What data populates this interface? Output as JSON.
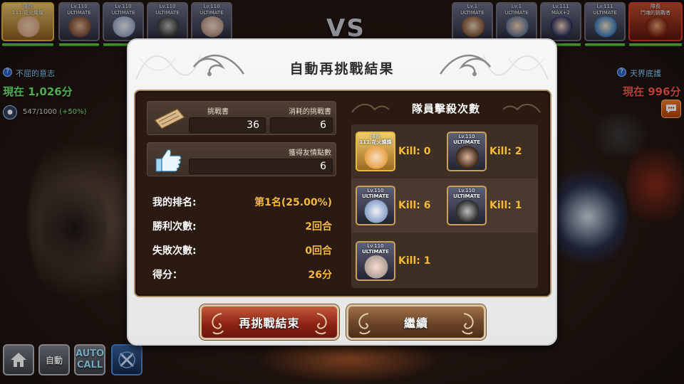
{
  "colors": {
    "gold_text": "#f5b93a",
    "player_score": "#6ff06a",
    "enemy_score": "#ff5a4a",
    "info_blue": "#8fd0ff",
    "end_button": "#8e2414",
    "continue_button": "#6b4428"
  },
  "battle": {
    "vs": "VS",
    "player_team": [
      {
        "level": "隊長",
        "tier": "111.花火燦燦",
        "role": "leader",
        "hp": 1.0
      },
      {
        "level": "Lv.110",
        "tier": "ULTIMATE",
        "hp": 1.0
      },
      {
        "level": "Lv.110",
        "tier": "ULTIMATE",
        "hp": 1.0
      },
      {
        "level": "Lv.110",
        "tier": "ULTIMATE",
        "hp": 1.0
      },
      {
        "level": "Lv.110",
        "tier": "ULTIMATE",
        "hp": 1.0
      }
    ],
    "enemy_team": [
      {
        "level": "Lv.1",
        "tier": "ULTIMATE",
        "hp": 1.0
      },
      {
        "level": "Lv.1",
        "tier": "ULTIMATE",
        "hp": 1.0
      },
      {
        "level": "Lv.111",
        "tier": "MAX+2",
        "hp": 1.0
      },
      {
        "level": "Lv.111",
        "tier": "ULTIMATE",
        "hp": 1.0
      },
      {
        "level": "隊長",
        "tier": "鬥魂的挑戰者",
        "role": "enemy-leader",
        "hp": 1.0
      }
    ],
    "player_title": "不屈的意志",
    "player_score": "現在 1,026分",
    "player_energy": "547/1000",
    "player_energy_bonus": "(+50%)",
    "enemy_title": "天界底護",
    "enemy_score": "現在 996分"
  },
  "bottom_controls": {
    "home_icon": "home-icon",
    "auto_label": "自動",
    "auto_call_label": "AUTO\nCALL",
    "skill_icon": "crossed-swords-icon"
  },
  "modal": {
    "title": "自動再挑戰結果",
    "tickets_label": "挑戰書",
    "tickets_value": "36",
    "consumed_label": "消耗的挑戰書",
    "consumed_value": "6",
    "friendship_label": "獲得友情點數",
    "friendship_value": "6",
    "stats": [
      {
        "label": "我的排名:",
        "value": "第1名(25.00%)"
      },
      {
        "label": "勝利次數:",
        "value": "2回合"
      },
      {
        "label": "失敗次數:",
        "value": "0回合"
      },
      {
        "label": "得分：",
        "value": "26分"
      }
    ],
    "kills_title": "隊員擊殺次數",
    "kills": [
      {
        "level": "隊長",
        "tier": "111.花火燦燦",
        "kill": "Kill: 0",
        "style": "gold"
      },
      {
        "level": "Lv.110",
        "tier": "ULTIMATE",
        "kill": "Kill: 2"
      },
      {
        "level": "Lv.110",
        "tier": "ULTIMATE",
        "kill": "Kill: 6"
      },
      {
        "level": "Lv.110",
        "tier": "ULTIMATE",
        "kill": "Kill: 1"
      },
      {
        "level": "Lv.110",
        "tier": "ULTIMATE",
        "kill": "Kill: 1"
      }
    ],
    "end_button": "再挑戰結束",
    "continue_button": "繼續"
  }
}
